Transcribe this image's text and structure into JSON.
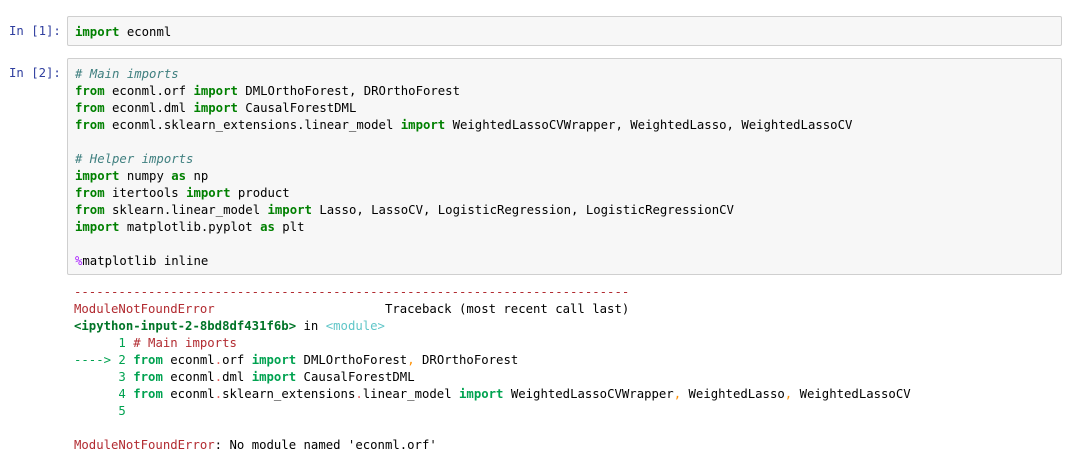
{
  "cells": [
    {
      "prompt": "In [1]:",
      "lines": [
        [
          {
            "t": "import",
            "c": "kw"
          },
          {
            "t": " econml"
          }
        ]
      ]
    },
    {
      "prompt": "In [2]:",
      "lines": [
        [
          {
            "t": "# Main imports",
            "c": "cm"
          }
        ],
        [
          {
            "t": "from",
            "c": "kw"
          },
          {
            "t": " econml.orf "
          },
          {
            "t": "import",
            "c": "kw"
          },
          {
            "t": " DMLOrthoForest, DROrthoForest"
          }
        ],
        [
          {
            "t": "from",
            "c": "kw"
          },
          {
            "t": " econml.dml "
          },
          {
            "t": "import",
            "c": "kw"
          },
          {
            "t": " CausalForestDML"
          }
        ],
        [
          {
            "t": "from",
            "c": "kw"
          },
          {
            "t": " econml.sklearn_extensions.linear_model "
          },
          {
            "t": "import",
            "c": "kw"
          },
          {
            "t": " WeightedLassoCVWrapper, WeightedLasso, WeightedLassoCV"
          }
        ],
        [],
        [
          {
            "t": "# Helper imports",
            "c": "cm"
          }
        ],
        [
          {
            "t": "import",
            "c": "kw"
          },
          {
            "t": " numpy "
          },
          {
            "t": "as",
            "c": "kw"
          },
          {
            "t": " np"
          }
        ],
        [
          {
            "t": "from",
            "c": "kw"
          },
          {
            "t": " itertools "
          },
          {
            "t": "import",
            "c": "kw"
          },
          {
            "t": " product"
          }
        ],
        [
          {
            "t": "from",
            "c": "kw"
          },
          {
            "t": " sklearn.linear_model "
          },
          {
            "t": "import",
            "c": "kw"
          },
          {
            "t": " Lasso, LassoCV, LogisticRegression, LogisticRegressionCV"
          }
        ],
        [
          {
            "t": "import",
            "c": "kw"
          },
          {
            "t": " matplotlib.pyplot "
          },
          {
            "t": "as",
            "c": "kw"
          },
          {
            "t": " plt"
          }
        ],
        [],
        [
          {
            "t": "%",
            "c": "mg"
          },
          {
            "t": "matplotlib inline"
          }
        ]
      ]
    }
  ],
  "output": {
    "lines": [
      [
        {
          "t": "---------------------------------------------------------------------------",
          "c": "red"
        }
      ],
      [
        {
          "t": "ModuleNotFoundError",
          "c": "red"
        },
        {
          "t": "                       Traceback (most recent call last)"
        }
      ],
      [
        {
          "t": "<ipython-input-2-8bd8df431f6b>",
          "c": "grn"
        },
        {
          "t": " in "
        },
        {
          "t": "<module>",
          "c": "cy"
        }
      ],
      [
        {
          "t": "      1 ",
          "c": "gr"
        },
        {
          "t": "# Main imports",
          "c": "red"
        }
      ],
      [
        {
          "t": "----> 2 ",
          "c": "gr"
        },
        {
          "t": "from",
          "c": "grb"
        },
        {
          "t": " econml"
        },
        {
          "t": ".",
          "c": "rd"
        },
        {
          "t": "orf "
        },
        {
          "t": "import",
          "c": "grb"
        },
        {
          "t": " DMLOrthoForest"
        },
        {
          "t": ",",
          "c": "ora"
        },
        {
          "t": " DROrthoForest"
        }
      ],
      [
        {
          "t": "      3 ",
          "c": "gr"
        },
        {
          "t": "from",
          "c": "grb"
        },
        {
          "t": " econml"
        },
        {
          "t": ".",
          "c": "rd"
        },
        {
          "t": "dml "
        },
        {
          "t": "import",
          "c": "grb"
        },
        {
          "t": " CausalForestDML"
        }
      ],
      [
        {
          "t": "      4 ",
          "c": "gr"
        },
        {
          "t": "from",
          "c": "grb"
        },
        {
          "t": " econml"
        },
        {
          "t": ".",
          "c": "rd"
        },
        {
          "t": "sklearn_extensions"
        },
        {
          "t": ".",
          "c": "rd"
        },
        {
          "t": "linear_model "
        },
        {
          "t": "import",
          "c": "grb"
        },
        {
          "t": " WeightedLassoCVWrapper"
        },
        {
          "t": ",",
          "c": "ora"
        },
        {
          "t": " WeightedLasso"
        },
        {
          "t": ",",
          "c": "ora"
        },
        {
          "t": " WeightedLassoCV"
        }
      ],
      [
        {
          "t": "      5",
          "c": "gr"
        }
      ],
      [],
      [
        {
          "t": "ModuleNotFoundError",
          "c": "red"
        },
        {
          "t": ": No module named 'econml.orf'"
        }
      ]
    ]
  }
}
